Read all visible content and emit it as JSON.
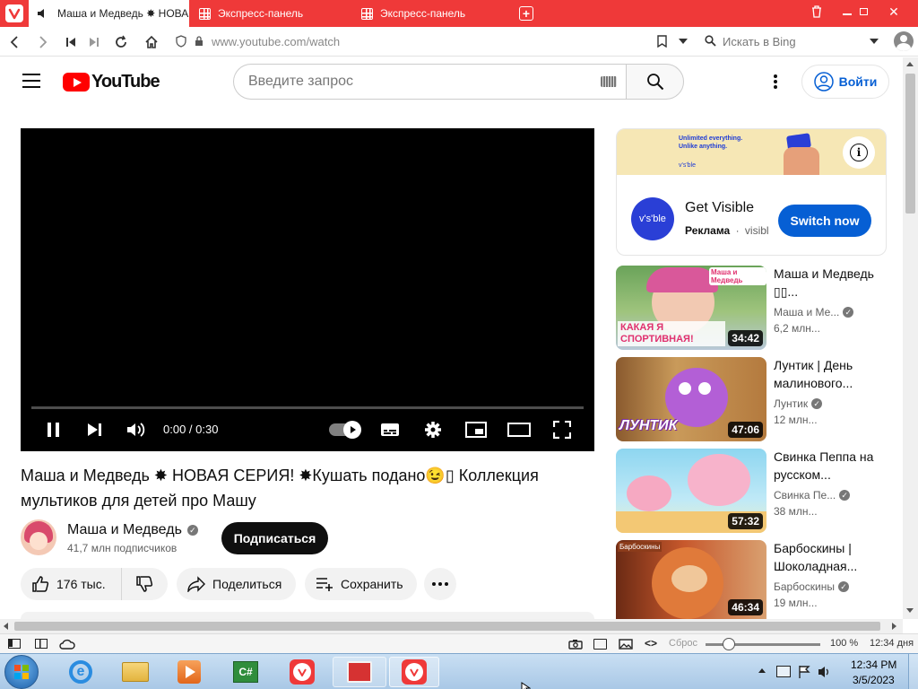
{
  "browser": {
    "tabs": [
      {
        "label": "Маша и Медведь ✸ НОВА"
      },
      {
        "label": "Экспресс-панель"
      },
      {
        "label": "Экспресс-панель"
      }
    ],
    "url_host": "www.youtube.com",
    "url_path": "/watch",
    "search_placeholder": "Искать в Bing"
  },
  "youtube": {
    "logo_text": "YouTube",
    "search_placeholder": "Введите запрос",
    "signin_label": "Войти",
    "player": {
      "time": "0:00 / 0:30",
      "progress": 0
    },
    "video_title": "Маша и Медведь ✸ НОВАЯ СЕРИЯ! ✸Кушать подано😉▯ Коллекция мультиков для детей про Машу",
    "channel": {
      "name": "Маша и Медведь",
      "subscribers": "41,7 млн подписчиков",
      "subscribe_label": "Подписаться"
    },
    "actions": {
      "likes": "176 тыс.",
      "share": "Поделиться",
      "save": "Сохранить"
    },
    "ad": {
      "banner_line1": "Unlimited everything.",
      "banner_line2": "Unlike anything.",
      "banner_brand": "v's'ble",
      "logo_text": "v's'ble",
      "title": "Get Visible",
      "sponsored": "Реклама",
      "domain": "visibl",
      "cta": "Switch now"
    },
    "recommendations": [
      {
        "title": "Маша и Медведь ▯▯...",
        "channel": "Маша и Ме...",
        "views": "6,2 млн...",
        "duration": "34:42",
        "thumb_text": "КАКАЯ Я СПОРТИВНАЯ!",
        "thumb_brand": "Маша и Медведь"
      },
      {
        "title": "Лунтик | День малинового...",
        "channel": "Лунтик",
        "views": "12 млн...",
        "duration": "47:06",
        "thumb_text": "ЛУНТИК"
      },
      {
        "title": "Свинка Пеппа на русском...",
        "channel": "Свинка Пе...",
        "views": "38 млн...",
        "duration": "57:32"
      },
      {
        "title": "Барбоскины | Шоколадная...",
        "channel": "Барбоскины",
        "views": "19 млн...",
        "duration": "46:34",
        "thumb_text": "Барбоскины"
      }
    ]
  },
  "statusbar": {
    "reset_label": "Сброс",
    "zoom": "100 %",
    "zoom_level": 0.15,
    "clock": "12:34 дня"
  },
  "taskbar": {
    "time": "12:34 PM",
    "date": "3/5/2023"
  },
  "colors": {
    "vivaldi_red": "#ef3939",
    "yt_red": "#ff0000",
    "subscribe_bg": "#0f0f0f",
    "cta_blue": "#065fd4"
  }
}
